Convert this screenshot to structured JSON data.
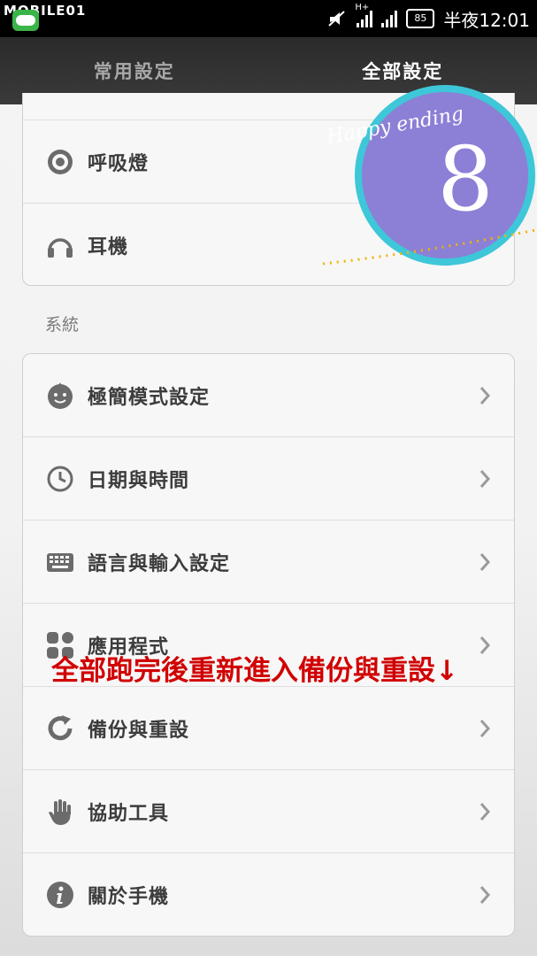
{
  "statusbar": {
    "watermark": "MOBILE01",
    "line_label": "LINE",
    "network_type": "H+",
    "battery": "85",
    "time": "半夜12:01"
  },
  "tabs": [
    {
      "label": "常用設定",
      "active": false
    },
    {
      "label": "全部設定",
      "active": true
    }
  ],
  "top_card": {
    "items": [
      {
        "label": "呼吸燈",
        "icon": "notification-light-icon"
      },
      {
        "label": "耳機",
        "icon": "headphones-icon"
      }
    ]
  },
  "system_section": {
    "header": "系統",
    "items": [
      {
        "label": "極簡模式設定",
        "icon": "simple-mode-icon"
      },
      {
        "label": "日期與時間",
        "icon": "clock-icon"
      },
      {
        "label": "語言與輸入設定",
        "icon": "keyboard-icon"
      },
      {
        "label": "應用程式",
        "icon": "apps-icon"
      },
      {
        "label": "備份與重設",
        "icon": "backup-reset-icon"
      },
      {
        "label": "協助工具",
        "icon": "hand-icon"
      },
      {
        "label": "關於手機",
        "icon": "info-icon"
      }
    ]
  },
  "overlay": {
    "badge_text": "Happy ending",
    "badge_number": "8",
    "annotation": "全部跑完後重新進入備份與重設↓"
  },
  "colors": {
    "badge_fill": "#8c7fd6",
    "badge_ring": "#3ec7d8",
    "annotation": "#d10000",
    "tabbar": "#333333"
  }
}
